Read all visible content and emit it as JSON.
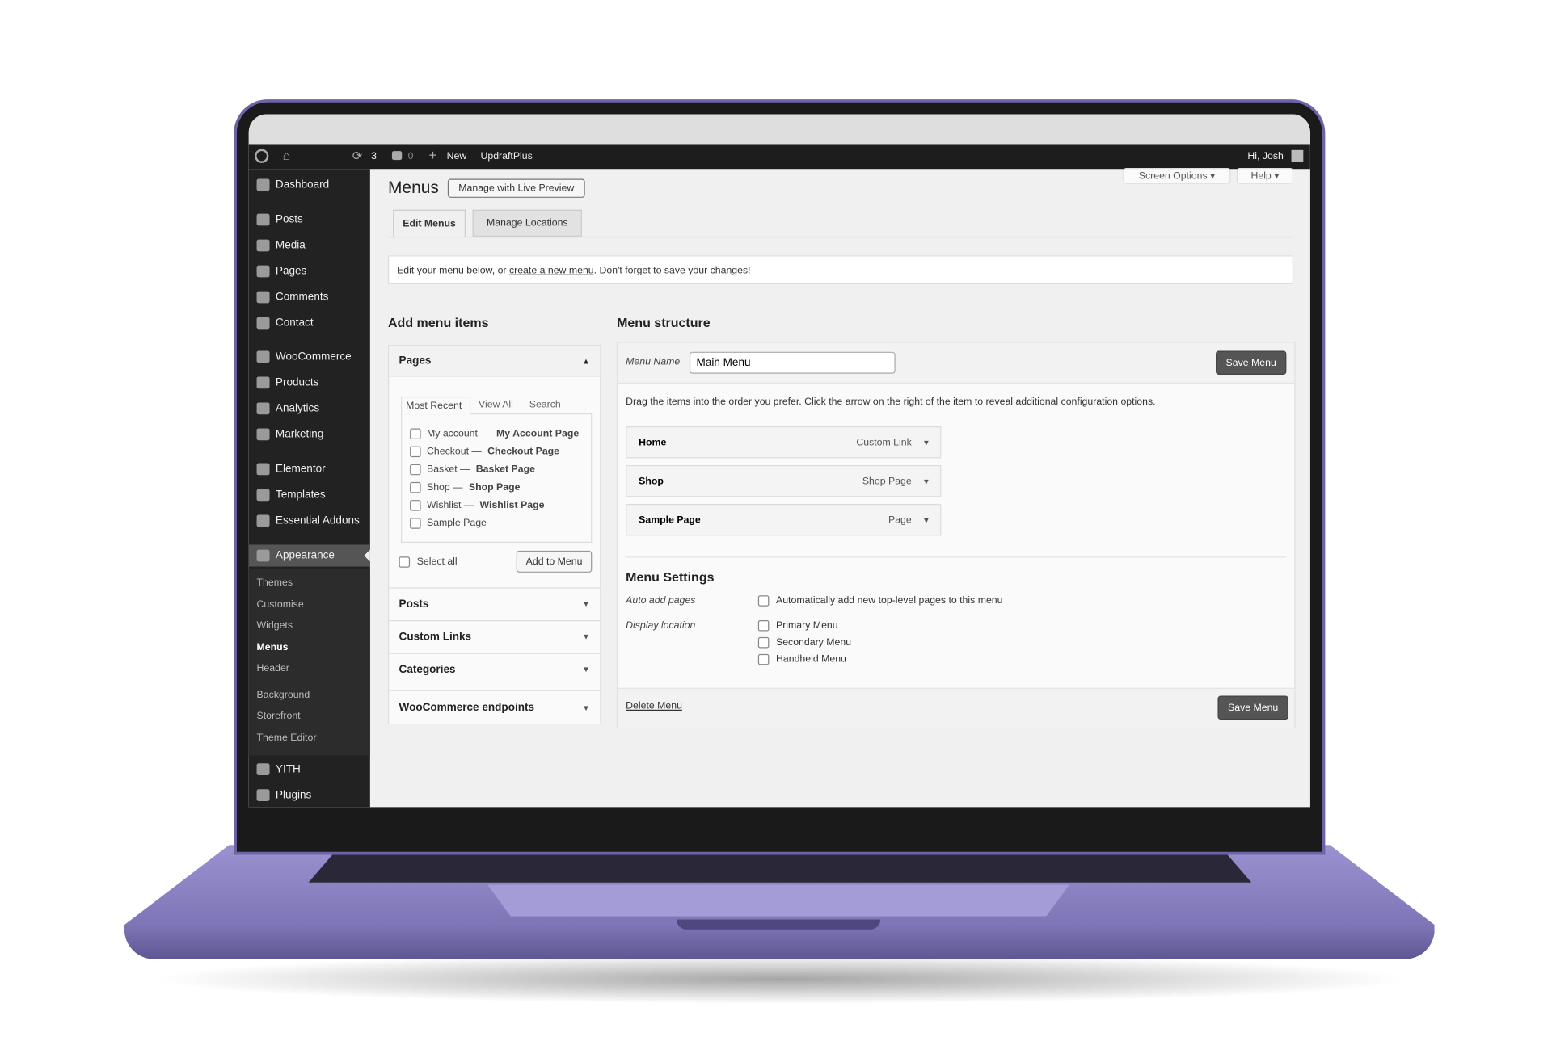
{
  "adminbar": {
    "updates": "3",
    "comments": "0",
    "new": "New",
    "plugin": "UpdraftPlus",
    "greeting": "Hi, Josh"
  },
  "sidebar": {
    "items": [
      "Dashboard",
      "Posts",
      "Media",
      "Pages",
      "Comments",
      "Contact",
      "WooCommerce",
      "Products",
      "Analytics",
      "Marketing",
      "Elementor",
      "Templates",
      "Essential Addons",
      "Appearance",
      "YITH",
      "Plugins"
    ],
    "submenu": [
      "Themes",
      "Customise",
      "Widgets",
      "Menus",
      "Header",
      "Background",
      "Storefront",
      "Theme Editor"
    ]
  },
  "header": {
    "title": "Menus",
    "live_preview": "Manage with Live Preview",
    "screen_options": "Screen Options ▾",
    "help": "Help ▾"
  },
  "tabs": [
    "Edit Menus",
    "Manage Locations"
  ],
  "notice": {
    "before": "Edit your menu below, or ",
    "link": "create a new menu",
    "after": ". Don't forget to save your changes!"
  },
  "add_items": {
    "title": "Add menu items",
    "pages_header": "Pages",
    "tabs": [
      "Most Recent",
      "View All",
      "Search"
    ],
    "pages": [
      [
        "My account — ",
        "My Account Page"
      ],
      [
        "Checkout — ",
        "Checkout Page"
      ],
      [
        "Basket — ",
        "Basket Page"
      ],
      [
        "Shop — ",
        "Shop Page"
      ],
      [
        "Wishlist — ",
        "Wishlist Page"
      ],
      [
        "Sample Page",
        ""
      ]
    ],
    "select_all": "Select all",
    "add_button": "Add to Menu",
    "sections": [
      "Posts",
      "Custom Links",
      "Categories",
      "WooCommerce endpoints"
    ]
  },
  "structure": {
    "title": "Menu structure",
    "name_label": "Menu Name",
    "name_value": "Main Menu",
    "save": "Save Menu",
    "instructions": "Drag the items into the order you prefer. Click the arrow on the right of the item to reveal additional configuration options.",
    "items": [
      {
        "title": "Home",
        "type": "Custom Link"
      },
      {
        "title": "Shop",
        "type": "Shop Page"
      },
      {
        "title": "Sample Page",
        "type": "Page"
      }
    ],
    "settings_title": "Menu Settings",
    "auto_label": "Auto add pages",
    "auto_option": "Automatically add new top-level pages to this menu",
    "location_label": "Display location",
    "locations": [
      "Primary Menu",
      "Secondary Menu",
      "Handheld Menu"
    ],
    "delete": "Delete Menu"
  },
  "colors": {
    "laptop": "#8a82c0",
    "adminbar": "#1d1d1d",
    "sidebar": "#222222",
    "button": "#555555"
  }
}
